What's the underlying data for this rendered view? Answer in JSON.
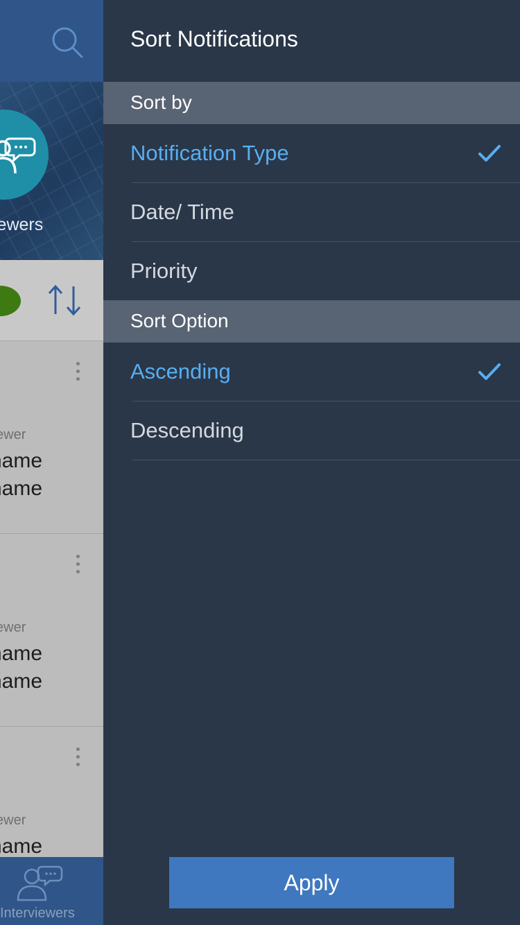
{
  "background": {
    "hero_label": "iewers",
    "cards": [
      {
        "role": "ewer",
        "name_line1": "name",
        "name_line2": "name"
      },
      {
        "role": "ewer",
        "name_line1": "name",
        "name_line2": "name"
      },
      {
        "role": "ewer",
        "name_line1": "name",
        "name_line2": ""
      }
    ],
    "tab_label": "Interviewers"
  },
  "drawer": {
    "title": "Sort Notifications",
    "sort_by": {
      "header": "Sort by",
      "options": [
        {
          "label": "Notification Type",
          "selected": true
        },
        {
          "label": "Date/ Time",
          "selected": false
        },
        {
          "label": "Priority",
          "selected": false
        }
      ]
    },
    "sort_option": {
      "header": "Sort Option",
      "options": [
        {
          "label": "Ascending",
          "selected": true
        },
        {
          "label": "Descending",
          "selected": false
        }
      ]
    },
    "apply_label": "Apply"
  },
  "colors": {
    "accent": "#58aef0",
    "drawer_bg": "#2a3749",
    "section_header_bg": "#586373",
    "apply_button": "#3f78bf",
    "app_bar": "#2f5589"
  },
  "icons": {
    "search": "search-icon",
    "sort": "sort-arrows-icon",
    "chat_users": "interviewers-icon",
    "check": "checkmark-icon",
    "more": "more-vertical-icon"
  }
}
